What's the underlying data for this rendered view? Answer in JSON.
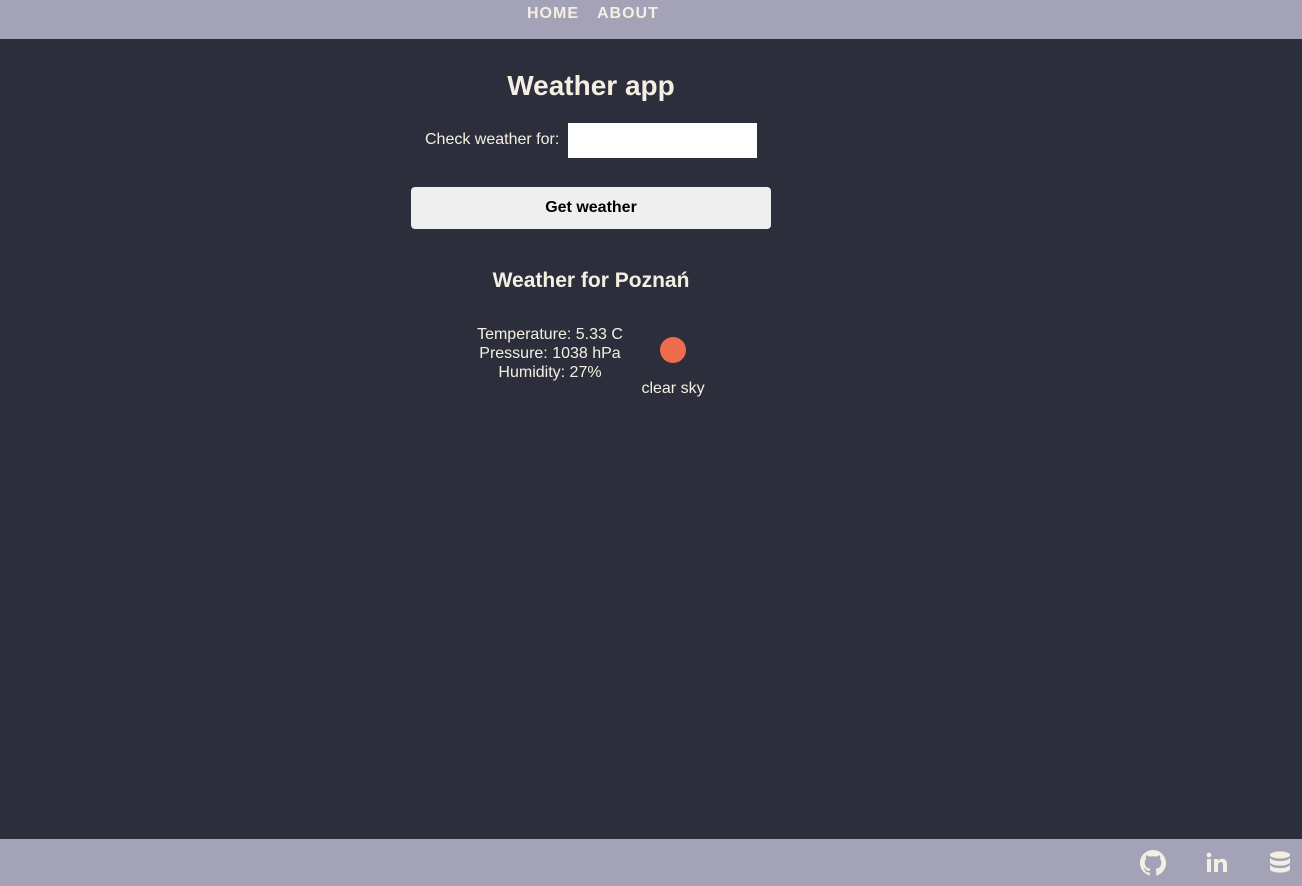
{
  "nav": {
    "home_label": "HOME",
    "about_label": "ABOUT"
  },
  "main": {
    "title": "Weather app",
    "input_label": "Check weather for:",
    "input_value": "",
    "button_label": "Get weather"
  },
  "result": {
    "heading": "Weather for Poznań",
    "temperature": "Temperature: 5.33 C",
    "pressure": "Pressure: 1038 hPa",
    "humidity": "Humidity: 27%",
    "description": "clear sky",
    "icon": "sun-icon"
  },
  "footer": {
    "icons": [
      "github-icon",
      "linkedin-icon",
      "database-icon"
    ]
  },
  "colors": {
    "background": "#2c2f3b",
    "bars": "#a3a2b6",
    "text": "#f5efe3",
    "sun": "#ee6c4d",
    "button": "#efefef"
  }
}
